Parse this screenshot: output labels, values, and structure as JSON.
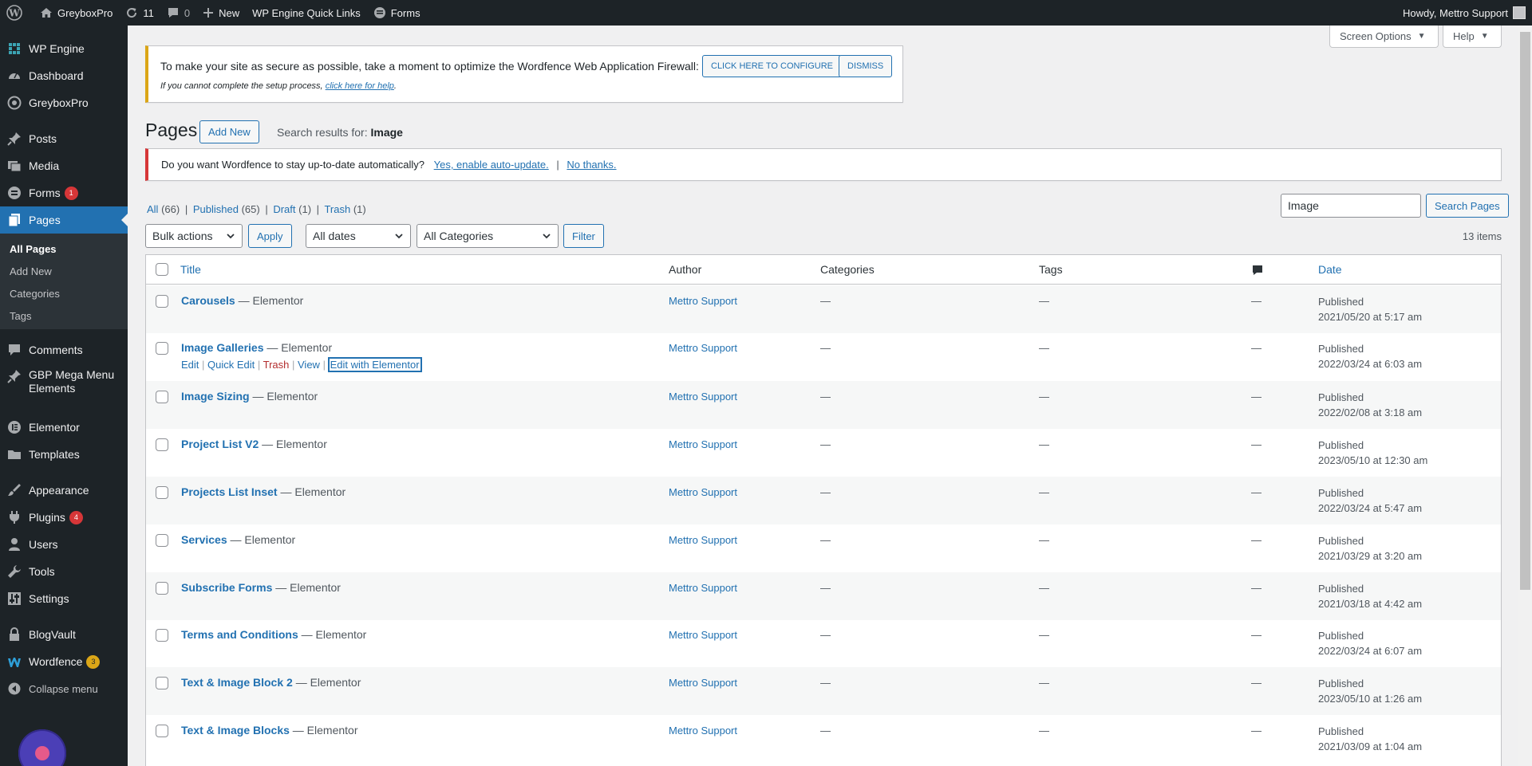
{
  "adminbar": {
    "site_name": "GreyboxPro",
    "updates_count": "11",
    "comments_count": "0",
    "new_label": "New",
    "quick_links": "WP Engine Quick Links",
    "forms_label": "Forms",
    "howdy": "Howdy, Mettro Support"
  },
  "sidebar": {
    "items": [
      {
        "label": "WP Engine"
      },
      {
        "label": "Dashboard"
      },
      {
        "label": "GreyboxPro"
      },
      {
        "label": "Posts"
      },
      {
        "label": "Media"
      },
      {
        "label": "Forms",
        "badge": "1"
      },
      {
        "label": "Pages"
      },
      {
        "label": "Comments"
      },
      {
        "label": "GBP Mega Menu Elements"
      },
      {
        "label": "Elementor"
      },
      {
        "label": "Templates"
      },
      {
        "label": "Appearance"
      },
      {
        "label": "Plugins",
        "badge": "4"
      },
      {
        "label": "Users"
      },
      {
        "label": "Tools"
      },
      {
        "label": "Settings"
      },
      {
        "label": "BlogVault"
      },
      {
        "label": "Wordfence",
        "badge": "3"
      },
      {
        "label": "Collapse menu"
      }
    ],
    "submenu": [
      "All Pages",
      "Add New",
      "Categories",
      "Tags"
    ]
  },
  "screen_options": "Screen Options",
  "help": "Help",
  "waf_notice": {
    "text": "To make your site as secure as possible, take a moment to optimize the Wordfence Web Application Firewall:",
    "configure": "CLICK HERE TO CONFIGURE",
    "dismiss": "DISMISS",
    "help_prefix": "If you cannot complete the setup process,",
    "help_link": "click here for help",
    "help_suffix": "."
  },
  "heading": {
    "title": "Pages",
    "add_new": "Add New",
    "search_prefix": "Search results for:",
    "search_term": "Image"
  },
  "update_notice": {
    "text": "Do you want Wordfence to stay up-to-date automatically?",
    "yes": "Yes, enable auto-update.",
    "sep": "|",
    "no": "No thanks."
  },
  "views": {
    "all": "All",
    "all_count": "(66)",
    "published": "Published",
    "published_count": "(65)",
    "draft": "Draft",
    "draft_count": "(1)",
    "trash": "Trash",
    "trash_count": "(1)"
  },
  "search": {
    "value": "Image",
    "button": "Search Pages"
  },
  "toolbar": {
    "bulk": "Bulk actions",
    "apply": "Apply",
    "dates": "All dates",
    "categories": "All Categories",
    "filter": "Filter",
    "items": "13 items"
  },
  "table": {
    "headers": {
      "title": "Title",
      "author": "Author",
      "categories": "Categories",
      "tags": "Tags",
      "date": "Date"
    },
    "row_actions": {
      "edit": "Edit",
      "quick_edit": "Quick Edit",
      "trash": "Trash",
      "view": "View",
      "elementor": "Edit with Elementor"
    },
    "rows": [
      {
        "title": "Carousels",
        "suffix": "— Elementor",
        "author": "Mettro Support",
        "cat": "—",
        "tags": "—",
        "comments": "—",
        "status": "Published",
        "date": "2021/05/20 at 5:17 am"
      },
      {
        "title": "Image Galleries",
        "suffix": "— Elementor",
        "author": "Mettro Support",
        "cat": "—",
        "tags": "—",
        "comments": "—",
        "status": "Published",
        "date": "2022/03/24 at 6:03 am"
      },
      {
        "title": "Image Sizing",
        "suffix": "— Elementor",
        "author": "Mettro Support",
        "cat": "—",
        "tags": "—",
        "comments": "—",
        "status": "Published",
        "date": "2022/02/08 at 3:18 am"
      },
      {
        "title": "Project List V2",
        "suffix": "— Elementor",
        "author": "Mettro Support",
        "cat": "—",
        "tags": "—",
        "comments": "—",
        "status": "Published",
        "date": "2023/05/10 at 12:30 am"
      },
      {
        "title": "Projects List Inset",
        "suffix": "— Elementor",
        "author": "Mettro Support",
        "cat": "—",
        "tags": "—",
        "comments": "—",
        "status": "Published",
        "date": "2022/03/24 at 5:47 am"
      },
      {
        "title": "Services",
        "suffix": "— Elementor",
        "author": "Mettro Support",
        "cat": "—",
        "tags": "—",
        "comments": "—",
        "status": "Published",
        "date": "2021/03/29 at 3:20 am"
      },
      {
        "title": "Subscribe Forms",
        "suffix": "— Elementor",
        "author": "Mettro Support",
        "cat": "—",
        "tags": "—",
        "comments": "—",
        "status": "Published",
        "date": "2021/03/18 at 4:42 am"
      },
      {
        "title": "Terms and Conditions",
        "suffix": "— Elementor",
        "author": "Mettro Support",
        "cat": "—",
        "tags": "—",
        "comments": "—",
        "status": "Published",
        "date": "2022/03/24 at 6:07 am"
      },
      {
        "title": "Text & Image Block 2",
        "suffix": "— Elementor",
        "author": "Mettro Support",
        "cat": "—",
        "tags": "—",
        "comments": "—",
        "status": "Published",
        "date": "2023/05/10 at 1:26 am"
      },
      {
        "title": "Text & Image Blocks",
        "suffix": "— Elementor",
        "author": "Mettro Support",
        "cat": "—",
        "tags": "—",
        "comments": "—",
        "status": "Published",
        "date": "2021/03/09 at 1:04 am"
      }
    ]
  }
}
